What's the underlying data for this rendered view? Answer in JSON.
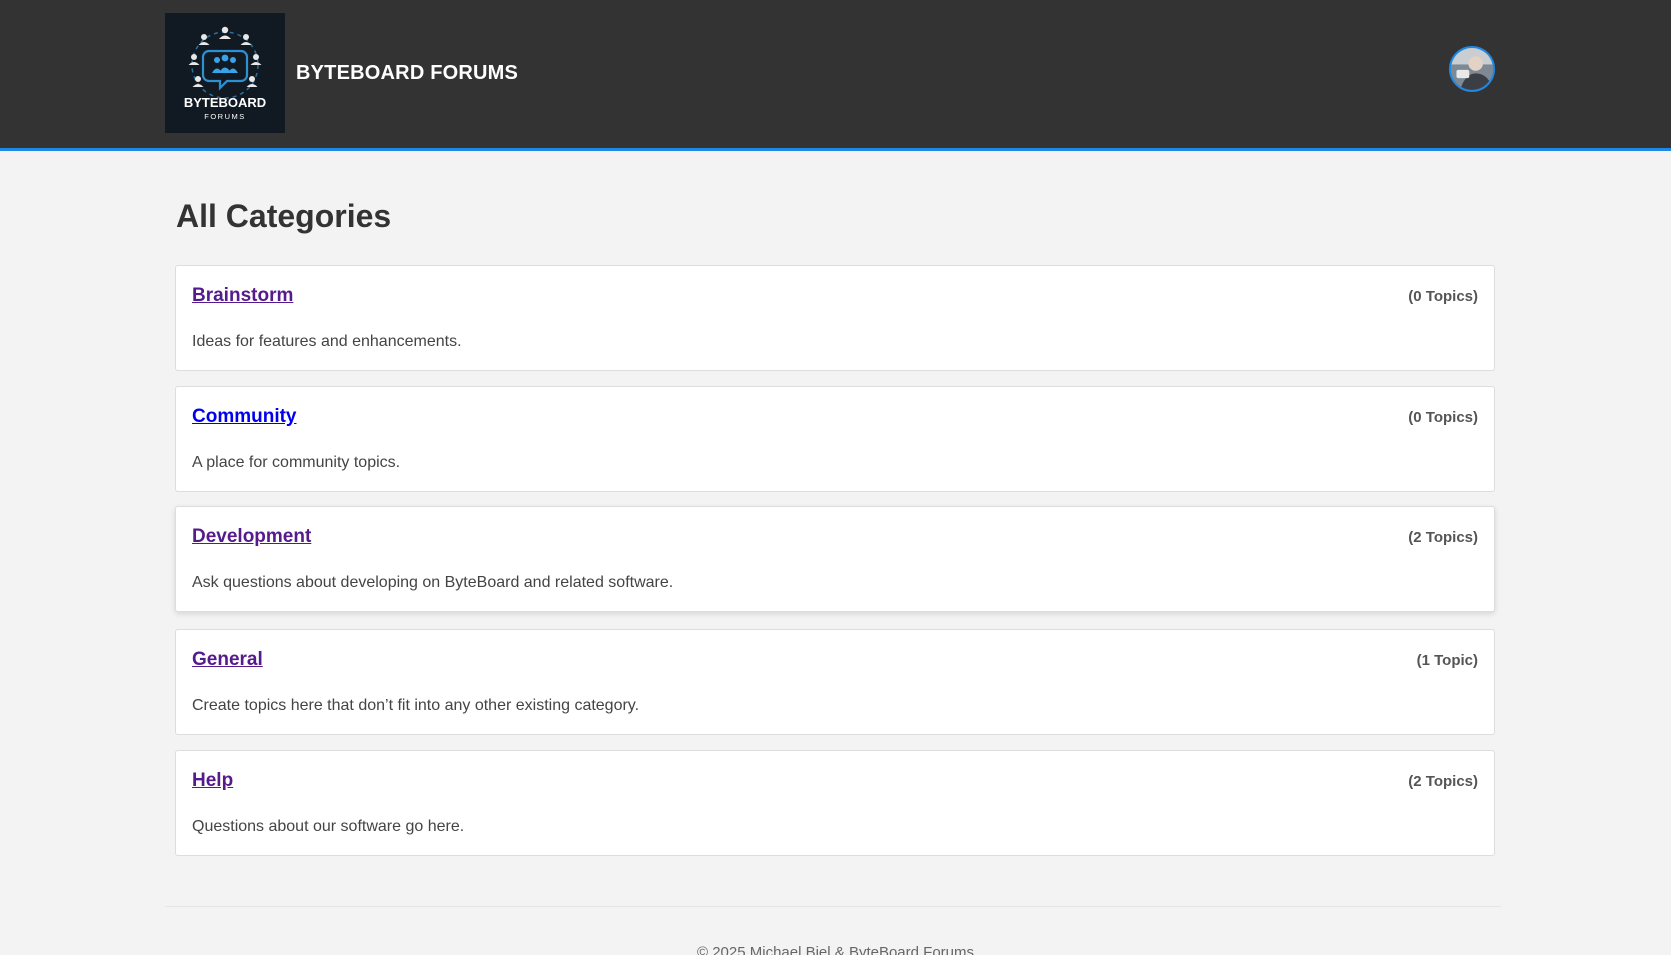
{
  "header": {
    "logo_text": "BYTEBOARD",
    "logo_subtext": "FORUMS",
    "site_title": "BYTEBOARD FORUMS"
  },
  "main": {
    "title": "All Categories",
    "categories": [
      {
        "name": "Brainstorm",
        "count": "(0 Topics)",
        "description": "Ideas for features and enhancements."
      },
      {
        "name": "Community",
        "count": "(0 Topics)",
        "description": "A place for community topics."
      },
      {
        "name": "Development",
        "count": "(2 Topics)",
        "description": "Ask questions about developing on ByteBoard and related software."
      },
      {
        "name": "General",
        "count": "(1 Topic)",
        "description": "Create topics here that don’t fit into any other existing category."
      },
      {
        "name": "Help",
        "count": "(2 Topics)",
        "description": "Questions about our software go here."
      }
    ]
  },
  "footer": {
    "copyright": "© 2025 Michael Biel & ByteBoard Forums"
  },
  "colors": {
    "header_bg": "#333333",
    "accent": "#1e88e5",
    "visited_link": "#551a8b",
    "link": "#0000ee"
  }
}
